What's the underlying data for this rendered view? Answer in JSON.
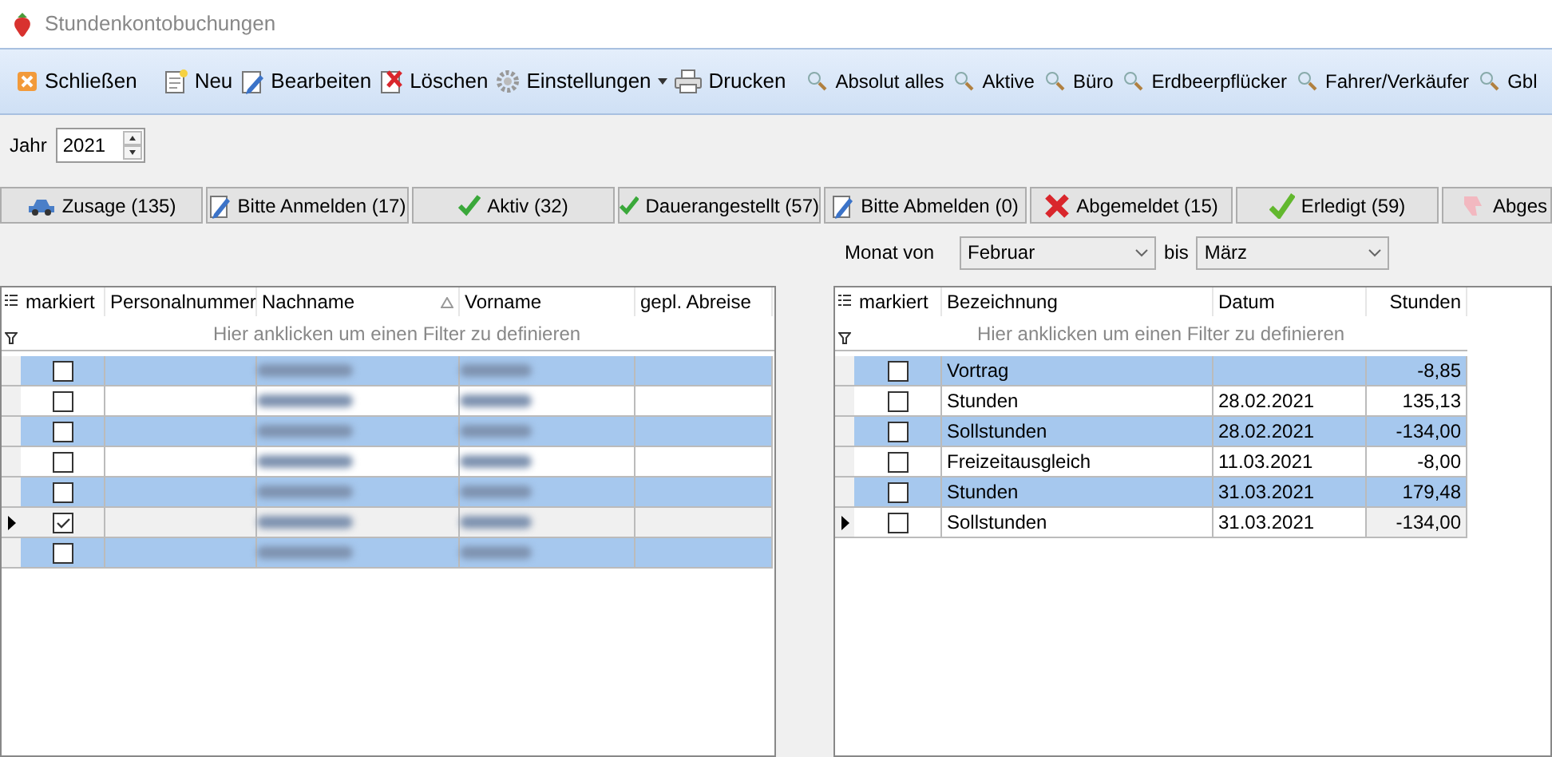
{
  "window": {
    "title": "Stundenkontobuchungen"
  },
  "toolbar": [
    {
      "label": "Schließen",
      "kind": "close"
    },
    {
      "label": "Neu",
      "kind": "new"
    },
    {
      "label": "Bearbeiten",
      "kind": "edit"
    },
    {
      "label": "Löschen",
      "kind": "delete"
    },
    {
      "label": "Einstellungen",
      "kind": "settings"
    },
    {
      "label": "Drucken",
      "kind": "print"
    }
  ],
  "filters": [
    "Absolut alles",
    "Aktive",
    "Büro",
    "Erdbeerpflücker",
    "Fahrer/Verkäufer",
    "Gbl"
  ],
  "year": {
    "label": "Jahr",
    "value": "2021"
  },
  "status_tabs": [
    {
      "label": "Zusage (135)",
      "kind": "car"
    },
    {
      "label": "Bitte Anmelden (17)",
      "kind": "edit"
    },
    {
      "label": "Aktiv (32)",
      "kind": "check"
    },
    {
      "label": "Dauerangestellt (57)",
      "kind": "check"
    },
    {
      "label": "Bitte Abmelden (0)",
      "kind": "edit"
    },
    {
      "label": "Abgemeldet (15)",
      "kind": "cross"
    },
    {
      "label": "Erledigt (59)",
      "kind": "bigcheck"
    },
    {
      "label": "Abges",
      "kind": "thumb"
    }
  ],
  "month_range": {
    "label_from": "Monat von",
    "from": "Februar",
    "label_to": "bis",
    "to": "März"
  },
  "employees": {
    "columns": [
      "markiert",
      "Personalnummer",
      "Nachname",
      "Vorname",
      "gepl. Abreise"
    ],
    "filter_hint": "Hier anklicken um einen Filter zu definieren",
    "rows": [
      {
        "checked": false,
        "current": false
      },
      {
        "checked": false,
        "current": false
      },
      {
        "checked": false,
        "current": false
      },
      {
        "checked": false,
        "current": false
      },
      {
        "checked": false,
        "current": false
      },
      {
        "checked": true,
        "current": true
      },
      {
        "checked": false,
        "current": false
      }
    ]
  },
  "bookings": {
    "columns": [
      "markiert",
      "Bezeichnung",
      "Datum",
      "Stunden"
    ],
    "filter_hint": "Hier anklicken um einen Filter zu definieren",
    "rows": [
      {
        "checked": false,
        "current": false,
        "label": "Vortrag",
        "date": "",
        "hours": "-8,85"
      },
      {
        "checked": false,
        "current": false,
        "label": "Stunden",
        "date": "28.02.2021",
        "hours": "135,13"
      },
      {
        "checked": false,
        "current": false,
        "label": "Sollstunden",
        "date": "28.02.2021",
        "hours": "-134,00"
      },
      {
        "checked": false,
        "current": false,
        "label": "Freizeitausgleich",
        "date": "11.03.2021",
        "hours": "-8,00"
      },
      {
        "checked": false,
        "current": false,
        "label": "Stunden",
        "date": "31.03.2021",
        "hours": "179,48"
      },
      {
        "checked": false,
        "current": true,
        "label": "Sollstunden",
        "date": "31.03.2021",
        "hours": "-134,00"
      }
    ]
  }
}
